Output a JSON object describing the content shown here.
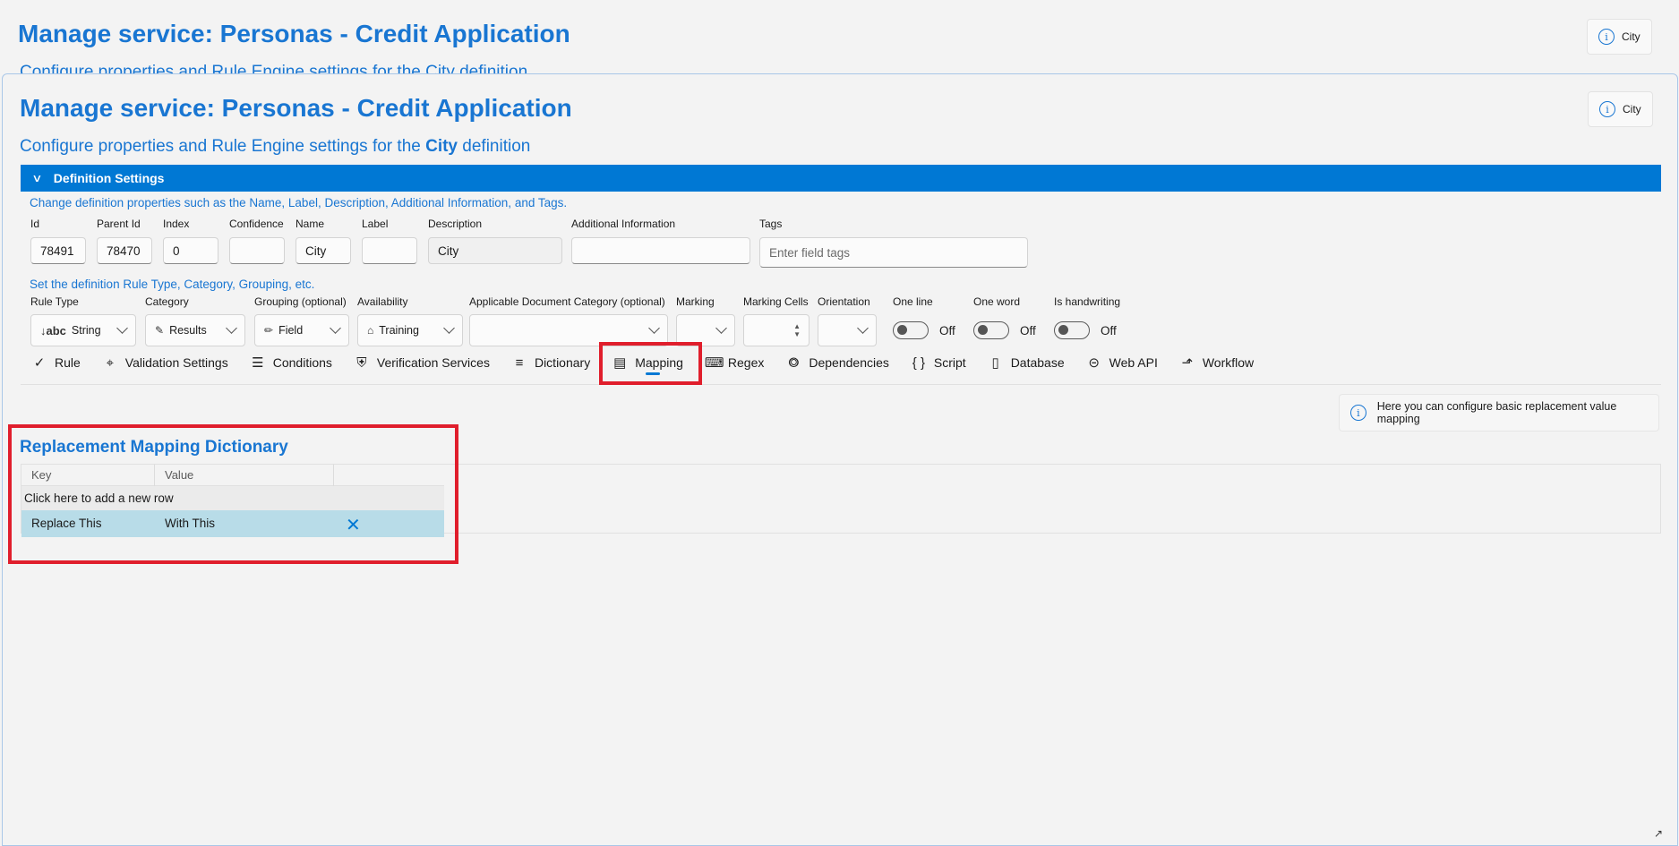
{
  "back_window": {
    "title": "Manage service: Personas - Credit Application",
    "subtitle": "Configure properties and Rule Engine settings for the City definition",
    "info_label": "City"
  },
  "header": {
    "title": "Manage service: Personas - Credit Application",
    "subtitle_pre": "Configure properties and Rule Engine settings for the ",
    "subtitle_bold": "City",
    "subtitle_post": " definition",
    "info_label": "City"
  },
  "section": {
    "label": "Definition Settings"
  },
  "properties": {
    "hint": "Change definition properties such as the Name, Label, Description, Additional Information, and Tags.",
    "fields": {
      "id": {
        "label": "Id",
        "value": "78491"
      },
      "parent_id": {
        "label": "Parent Id",
        "value": "78470"
      },
      "index": {
        "label": "Index",
        "value": "0"
      },
      "confidence": {
        "label": "Confidence",
        "value": ""
      },
      "name": {
        "label": "Name",
        "value": "City"
      },
      "label": {
        "label": "Label",
        "value": ""
      },
      "description": {
        "label": "Description",
        "value": "City"
      },
      "additional_info": {
        "label": "Additional Information",
        "value": ""
      },
      "tags": {
        "label": "Tags",
        "placeholder": "Enter field tags"
      }
    }
  },
  "rules": {
    "hint": "Set the definition Rule Type, Category, Grouping, etc.",
    "rule_type": {
      "label": "Rule Type",
      "value": "String",
      "icon": "sort-abc-icon",
      "glyph": "↓abc"
    },
    "category": {
      "label": "Category",
      "value": "Results",
      "icon": "pen-icon"
    },
    "grouping": {
      "label": "Grouping (optional)",
      "value": "Field",
      "icon": "pencil-icon"
    },
    "availability": {
      "label": "Availability",
      "value": "Training",
      "icon": "graduation-cap-icon"
    },
    "doc_category": {
      "label": "Applicable Document Category (optional)",
      "value": ""
    },
    "marking": {
      "label": "Marking",
      "value": ""
    },
    "marking_cells": {
      "label": "Marking Cells",
      "value": ""
    },
    "orientation": {
      "label": "Orientation",
      "value": ""
    },
    "one_line": {
      "label": "One line",
      "state": "Off"
    },
    "one_word": {
      "label": "One word",
      "state": "Off"
    },
    "handwriting": {
      "label": "Is handwriting",
      "state": "Off"
    }
  },
  "tabs": [
    {
      "label": "Rule",
      "icon": "check-icon",
      "glyph": "✓"
    },
    {
      "label": "Validation Settings",
      "icon": "validation-icon",
      "glyph": "⌖"
    },
    {
      "label": "Conditions",
      "icon": "conditions-list-icon",
      "glyph": "☰"
    },
    {
      "label": "Verification Services",
      "icon": "shield-icon",
      "glyph": "⛨"
    },
    {
      "label": "Dictionary",
      "icon": "list-icon",
      "glyph": "≡"
    },
    {
      "label": "Mapping",
      "icon": "mapping-book-icon",
      "glyph": "▤",
      "active": true
    },
    {
      "label": "Regex",
      "icon": "regex-icon",
      "glyph": "⌨"
    },
    {
      "label": "Dependencies",
      "icon": "dependencies-icon",
      "glyph": "⭗"
    },
    {
      "label": "Script",
      "icon": "braces-icon",
      "glyph": "{ }"
    },
    {
      "label": "Database",
      "icon": "database-icon",
      "glyph": "▯"
    },
    {
      "label": "Web API",
      "icon": "web-api-icon",
      "glyph": "⊝"
    },
    {
      "label": "Workflow",
      "icon": "workflow-icon",
      "glyph": "⬏"
    }
  ],
  "info_bar": {
    "text": "Here you can configure basic replacement value mapping"
  },
  "mapping": {
    "title": "Replacement Mapping Dictionary",
    "columns": [
      "Key",
      "Value"
    ],
    "add_row_label": "Click here to add a new row",
    "rows": [
      {
        "key": "Replace This",
        "value": "With This"
      }
    ]
  },
  "colors": {
    "accent": "#0078d4",
    "title": "#1976d2",
    "highlight": "#e01e2c",
    "selected_row": "#b8dce8"
  }
}
